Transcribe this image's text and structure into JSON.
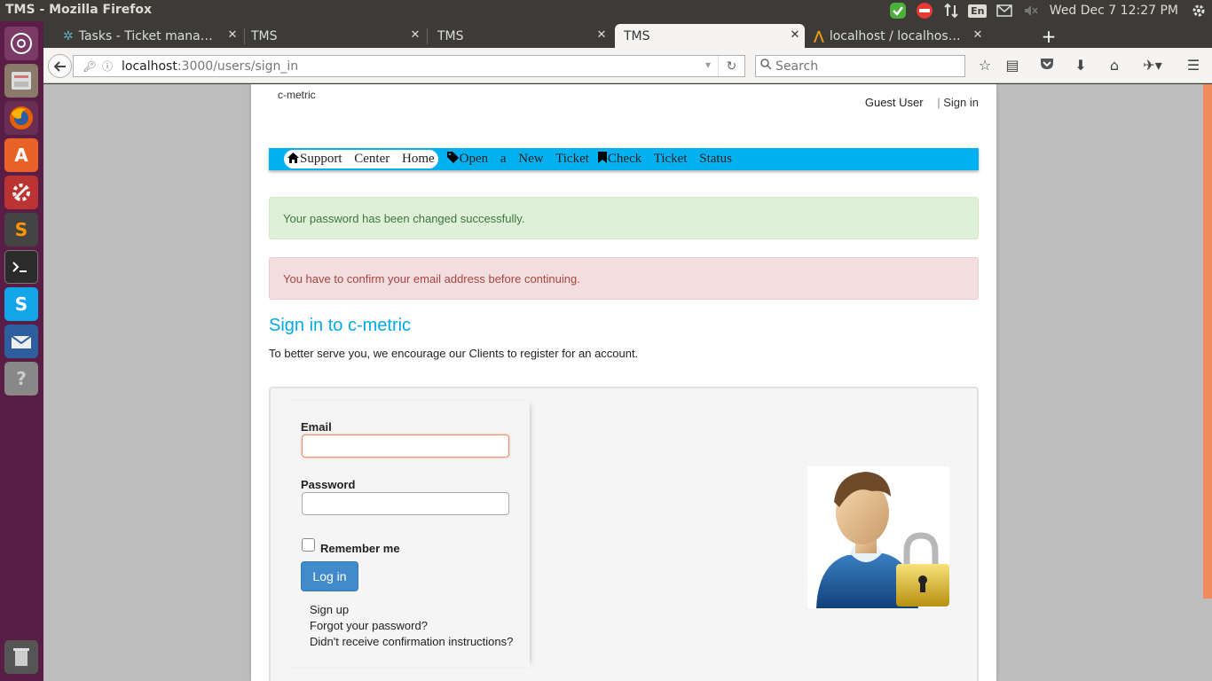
{
  "os": {
    "window_title": "TMS - Mozilla Firefox",
    "keyboard_layout": "En",
    "clock": "Wed Dec  7 12:27 PM"
  },
  "browser": {
    "tabs": [
      {
        "label": "Tasks - Ticket mana…",
        "active": false
      },
      {
        "label": "TMS",
        "active": false
      },
      {
        "label": "TMS",
        "active": false
      },
      {
        "label": "TMS",
        "active": true
      },
      {
        "label": "localhost / localhos…",
        "active": false
      }
    ],
    "url_host": "localhost",
    "url_path": ":3000/users/sign_in",
    "search_placeholder": "Search"
  },
  "site": {
    "logo_text": "c-metric",
    "user_name": "Guest User",
    "separator": "|",
    "sign_in_link": "Sign in",
    "menu": {
      "home": "Support Center Home",
      "open_ticket": "Open a New Ticket",
      "check_status": "Check Ticket Status"
    },
    "alerts": {
      "success": "Your password has been changed successfully.",
      "danger": "You have to confirm your email address before continuing."
    },
    "heading": "Sign in to c-metric",
    "intro": "To better serve you, we encourage our Clients to register for an account.",
    "form": {
      "email_label": "Email",
      "email_value": "",
      "password_label": "Password",
      "password_value": "",
      "remember_label": "Remember me",
      "remember_checked": false,
      "login_button": "Log in",
      "links": [
        "Sign up",
        "Forgot your password?",
        "Didn't receive confirmation instructions?"
      ]
    }
  },
  "colors": {
    "accent": "#03b0f0",
    "heading": "#03a9e8",
    "button": "#428bca",
    "launcher": "#5a1d45"
  }
}
